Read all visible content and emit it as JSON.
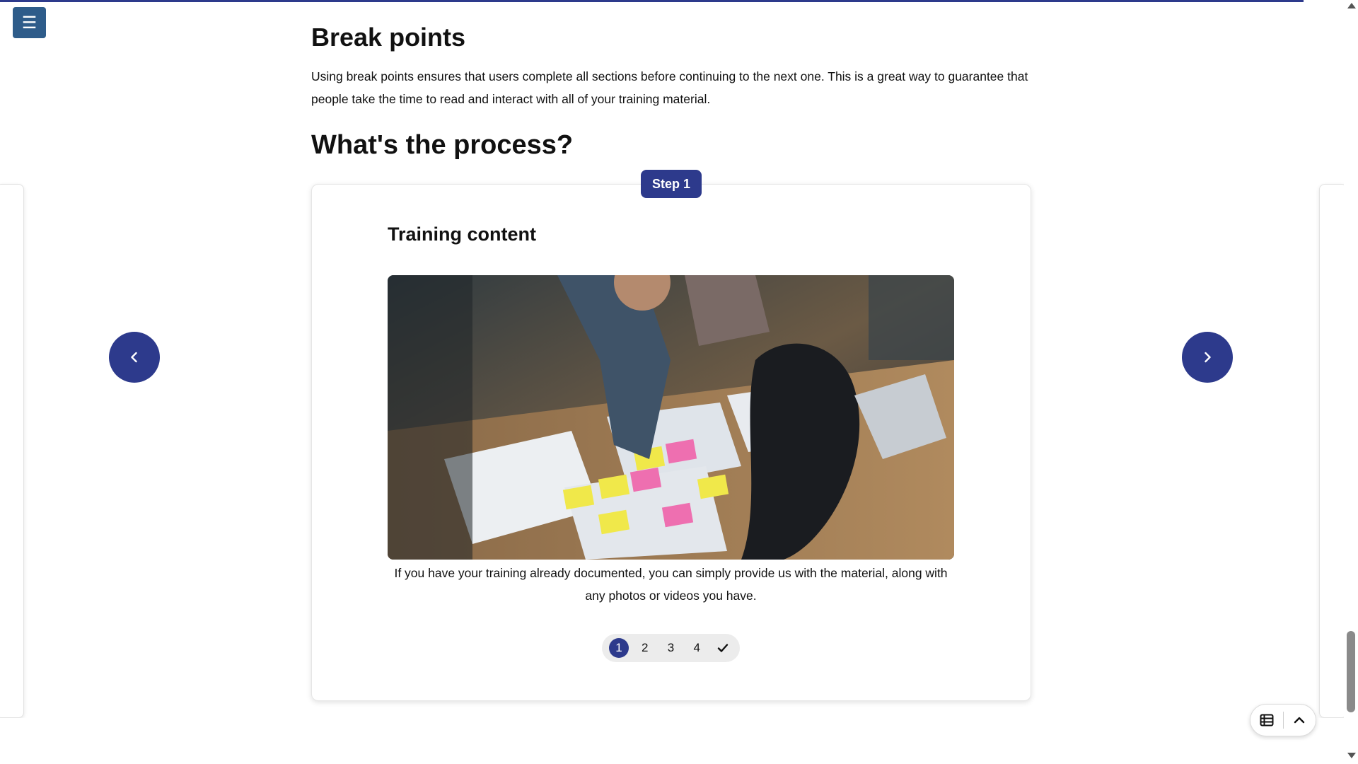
{
  "menu": {
    "icon": "hamburger-icon",
    "glyph": "☰"
  },
  "section": {
    "title": "Break points",
    "intro": "Using break points ensures that users complete all sections before continuing to the next one. This is a great way to guarantee that people take the time to read and interact with all of your training material."
  },
  "process": {
    "title": "What's the process?"
  },
  "carousel": {
    "step_badge": "Step 1",
    "card_title": "Training content",
    "caption": "If you have your training already documented, you can simply provide us with the material, along with any photos or videos you have.",
    "prev_icon": "chevron-left-icon",
    "next_icon": "chevron-right-icon",
    "steps": [
      {
        "label": "1",
        "active": true
      },
      {
        "label": "2",
        "active": false
      },
      {
        "label": "3",
        "active": false
      },
      {
        "label": "4",
        "active": false
      }
    ],
    "complete_icon": "checkmark-icon"
  },
  "toolbar": {
    "table_icon": "table-of-contents-icon",
    "top_icon": "chevron-up-icon"
  },
  "colors": {
    "accent": "#2d3a8c",
    "menu_button": "#2e5c8a"
  },
  "page_progress": 0.96
}
